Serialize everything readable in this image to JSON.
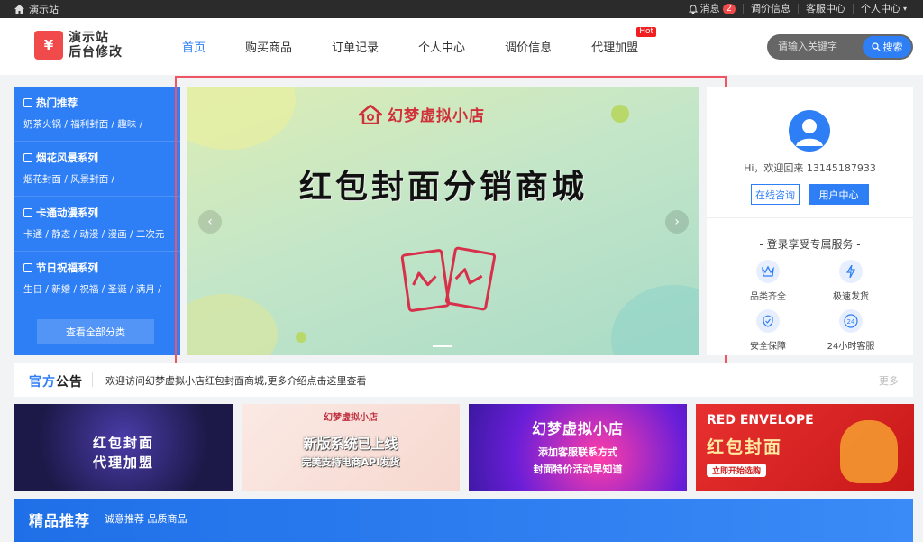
{
  "topbar": {
    "site_name": "演示站",
    "messages_label": "消息",
    "messages_count": "2",
    "price_info": "调价信息",
    "service_center": "客服中心",
    "personal_center": "个人中心"
  },
  "header": {
    "logo_text_line1": "演示站",
    "logo_text_line2": "后台修改",
    "nav": [
      {
        "label": "首页"
      },
      {
        "label": "购买商品"
      },
      {
        "label": "订单记录"
      },
      {
        "label": "个人中心"
      },
      {
        "label": "调价信息"
      },
      {
        "label": "代理加盟",
        "badge": "Hot"
      }
    ],
    "search_placeholder": "请输入关键字",
    "search_button": "搜索"
  },
  "categories": [
    {
      "title": "热门推荐",
      "sub": "奶茶火锅 / 福利封面 / 趣味 /"
    },
    {
      "title": "烟花风景系列",
      "sub": "烟花封面 / 风景封面 /"
    },
    {
      "title": "卡通动漫系列",
      "sub": "卡通 / 静态 / 动漫 / 漫画 / 二次元"
    },
    {
      "title": "节日祝福系列",
      "sub": "生日 / 新婚 / 祝福 / 圣诞 / 满月 /"
    }
  ],
  "view_all_categories": "查看全部分类",
  "banner": {
    "shop_name": "幻梦虚拟小店",
    "headline": "红包封面分销商城"
  },
  "user_panel": {
    "greeting": "Hi，欢迎回来 13145187933",
    "consult_button": "在线咨询",
    "center_button": "用户中心",
    "service_title": "- 登录享受专属服务 -",
    "services": [
      {
        "label": "品类齐全",
        "icon": "crown-icon"
      },
      {
        "label": "极速发货",
        "icon": "lightning-icon"
      },
      {
        "label": "安全保障",
        "icon": "shield-icon"
      },
      {
        "label": "24小时客服",
        "icon": "clock-24-icon"
      }
    ]
  },
  "notice": {
    "label_part1": "官方",
    "label_part2": "公告",
    "text": "欢迎访问幻梦虚拟小店红包封面商城,更多介绍点击这里查看",
    "more": "更多"
  },
  "promos": [
    {
      "line1": "红包封面",
      "line2": "代理加盟"
    },
    {
      "brand": "幻梦虚拟小店",
      "line1": "新版系统已上线",
      "line2": "完美支持电商API发货"
    },
    {
      "line1": "幻梦虚拟小店",
      "line2": "添加客服联系方式",
      "line3": "封面特价活动早知道"
    },
    {
      "line1": "RED ENVELOPE",
      "line2": "红包封面",
      "line3": "立即开始选购"
    }
  ],
  "featured": {
    "title": "精品推荐",
    "subtitle": "诚意推荐 品质商品"
  },
  "colors": {
    "accent": "#2e7ef5",
    "topbar": "#2b2b2b",
    "highlight_frame": "#f05565"
  }
}
